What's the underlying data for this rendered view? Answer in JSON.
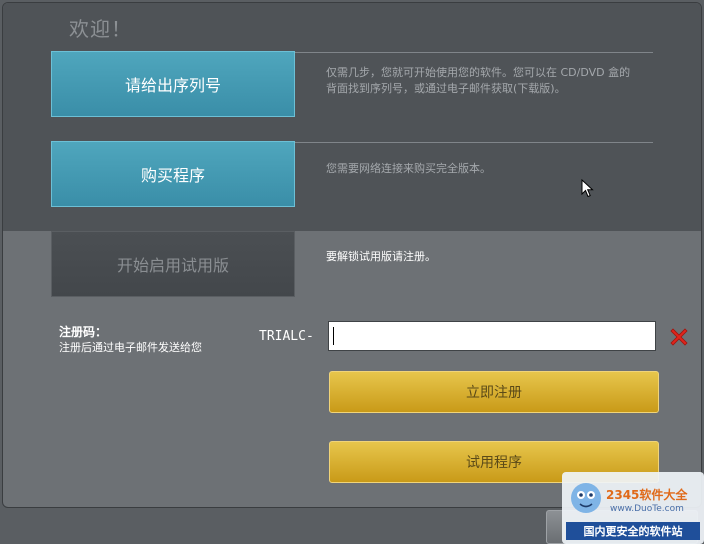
{
  "window": {
    "welcome": "欢迎！"
  },
  "options": {
    "serial_button": "请给出序列号",
    "serial_desc": "仅需几步，您就可开始使用您的软件。您可以在 CD/DVD 盒的背面找到序列号，或通过电子邮件获取(下载版)。",
    "buy_button": "购买程序",
    "buy_desc": "您需要网络连接来购买完全版本。",
    "trial_button": "开始启用试用版",
    "trial_desc": "要解锁试用版请注册。"
  },
  "registration": {
    "label": "注册码：",
    "sublabel": "注册后通过电子邮件发送给您",
    "prefix": "TRIALC-",
    "input_value": "",
    "register_button": "立即注册",
    "try_button": "试用程序"
  },
  "watermark": {
    "brand": "2345软件大全",
    "url": "www.DuoTe.com",
    "slogan": "国内更安全的软件站"
  },
  "colors": {
    "accent_blue": "#3a8ea8",
    "gold": "#d4ab2a",
    "clear_red": "#e0241c"
  },
  "icons": {
    "clear": "close-x-icon",
    "cursor": "mouse-pointer-icon"
  }
}
